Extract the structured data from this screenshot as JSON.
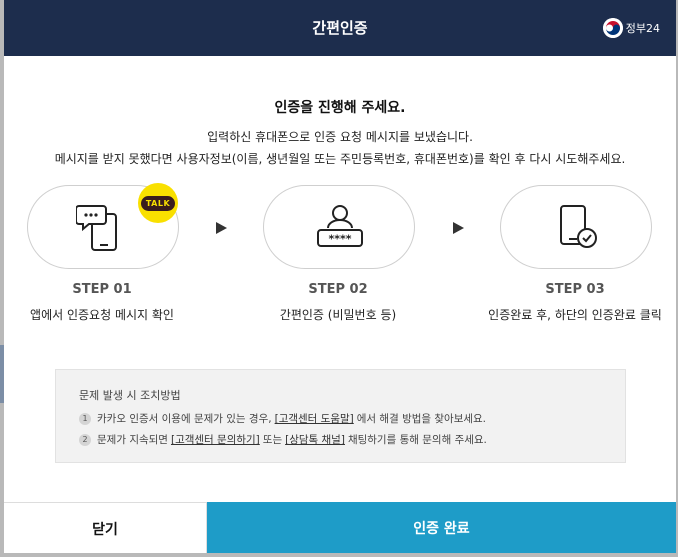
{
  "header": {
    "title": "간편인증",
    "logo_text": "정부24"
  },
  "intro": {
    "title": "인증을 진행해 주세요.",
    "line1": "입력하신 휴대폰으로 인증 요청 메시지를 보냈습니다.",
    "line2": "메시지를 받지 못했다면 사용자정보(이름, 생년월일 또는 주민등록번호, 휴대폰번호)를 확인 후 다시 시도해주세요."
  },
  "steps": [
    {
      "num": "STEP 01",
      "desc": "앱에서 인증요청 메시지 확인",
      "icon": "phone-message-icon"
    },
    {
      "num": "STEP 02",
      "desc": "간편인증 (비밀번호 등)",
      "icon": "user-password-icon"
    },
    {
      "num": "STEP 03",
      "desc": "인증완료 후, 하단의 인증완료 클릭",
      "icon": "phone-check-icon"
    }
  ],
  "talk_badge": "TALK",
  "help": {
    "title": "문제 발생 시 조치방법",
    "item1": {
      "num": "1",
      "pre": "카카오 인증서 이용에 문제가 있는 경우,",
      "link": "[고객센터 도움말]",
      "post": "에서 해결 방법을 찾아보세요."
    },
    "item2": {
      "num": "2",
      "pre": "문제가 지속되면",
      "link1": "[고객센터 문의하기]",
      "mid": "또는",
      "link2": "[상담톡 채널]",
      "post": "채팅하기를 통해 문의해 주세요."
    }
  },
  "footer": {
    "close_label": "닫기",
    "done_label": "인증 완료"
  },
  "colors": {
    "header_bg": "#1d2d4d",
    "primary": "#1e9cc8",
    "talk_yellow": "#f9e000"
  }
}
